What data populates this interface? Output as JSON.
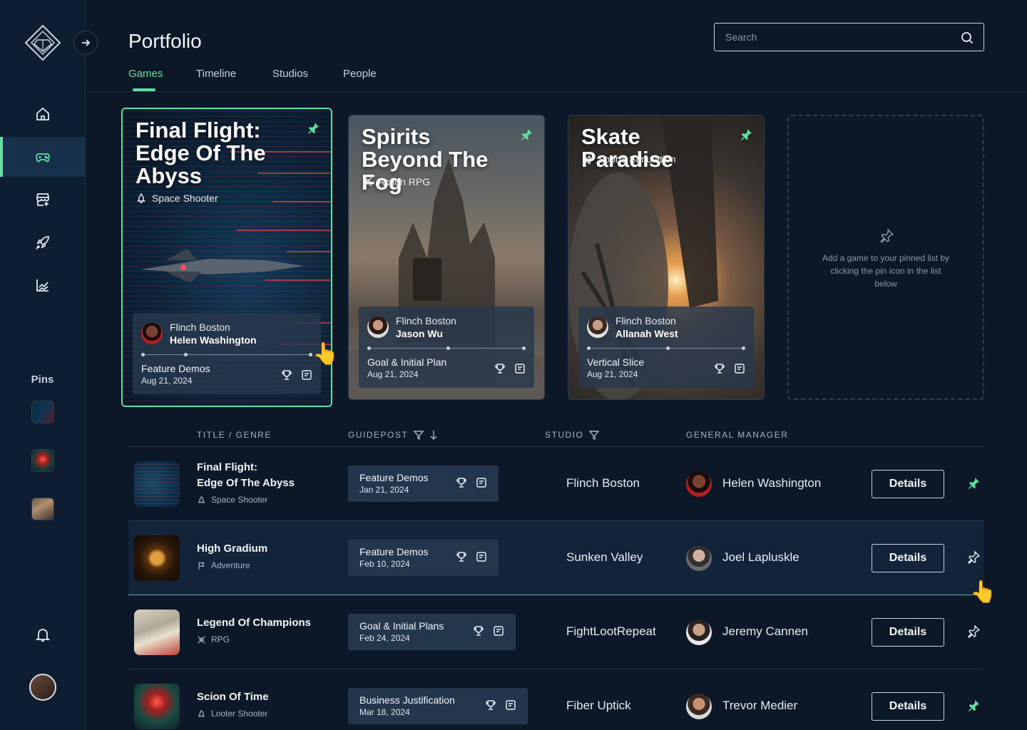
{
  "app": {
    "title": "Portfolio"
  },
  "search": {
    "placeholder": "Search"
  },
  "tabs": [
    {
      "label": "Games",
      "active": true
    },
    {
      "label": "Timeline"
    },
    {
      "label": "Studios"
    },
    {
      "label": "People"
    }
  ],
  "sidebar": {
    "items": [
      "home-icon",
      "gamepad-icon",
      "store-icon",
      "rocket-icon",
      "chart-icon"
    ],
    "active": "gamepad-icon",
    "pins_label": "Pins"
  },
  "colors": {
    "accent": "#5fe0a0",
    "background": "#0c1828",
    "panel": "#24364c"
  },
  "pinned_cards": [
    {
      "title": "Final Flight: Edge Of The Abyss",
      "genre": "Space Shooter",
      "studio": "Flinch Boston",
      "gm": "Helen Washington",
      "stage": "Feature Demos",
      "date": "Aug 21, 2024",
      "progress": 0.25,
      "selected": true
    },
    {
      "title": "Spirits Beyond The Fog",
      "genre": "Action RPG",
      "studio": "Flinch Boston",
      "gm": "Jason Wu",
      "stage": "Goal & Initial Plan",
      "date": "Aug 21, 2024",
      "progress": 0.5
    },
    {
      "title": "Skate Paradise",
      "genre": "Sports Simulation",
      "studio": "Flinch Boston",
      "gm": "Allanah West",
      "stage": "Vertical Slice",
      "date": "Aug 21, 2024",
      "progress": 0.5
    }
  ],
  "empty_pin": {
    "text": "Add a game to your pinned list by clicking the pin icon in the list below"
  },
  "table": {
    "headers": {
      "title": "TITLE / GENRE",
      "guidepost": "GUIDEPOST",
      "studio": "STUDIO",
      "gm": "GENERAL MANAGER"
    },
    "details_label": "Details",
    "rows": [
      {
        "title_line1": "Final Flight:",
        "title_line2": "Edge Of The Abyss",
        "genre": "Space Shooter",
        "stage": "Feature Demos",
        "date": "Jan 21, 2024",
        "studio": "Flinch Boston",
        "gm": "Helen Washington",
        "pinned": true
      },
      {
        "title_line1": "High Gradium",
        "title_line2": "",
        "genre": "Adventure",
        "stage": "Feature Demos",
        "date": "Feb 10, 2024",
        "studio": "Sunken Valley",
        "gm": "Joel Lapluskle",
        "pinned": false
      },
      {
        "title_line1": "Legend Of Champions",
        "title_line2": "",
        "genre": "RPG",
        "stage": "Goal & Initial Plans",
        "date": "Feb 24, 2024",
        "studio": "FightLootRepeat",
        "gm": "Jeremy Cannen",
        "pinned": false
      },
      {
        "title_line1": "Scion Of Time",
        "title_line2": "",
        "genre": "Looter Shooter",
        "stage": "Business Justification",
        "date": "Mar 18, 2024",
        "studio": "Fiber Uptick",
        "gm": "Trevor Medier",
        "pinned": true
      }
    ]
  }
}
